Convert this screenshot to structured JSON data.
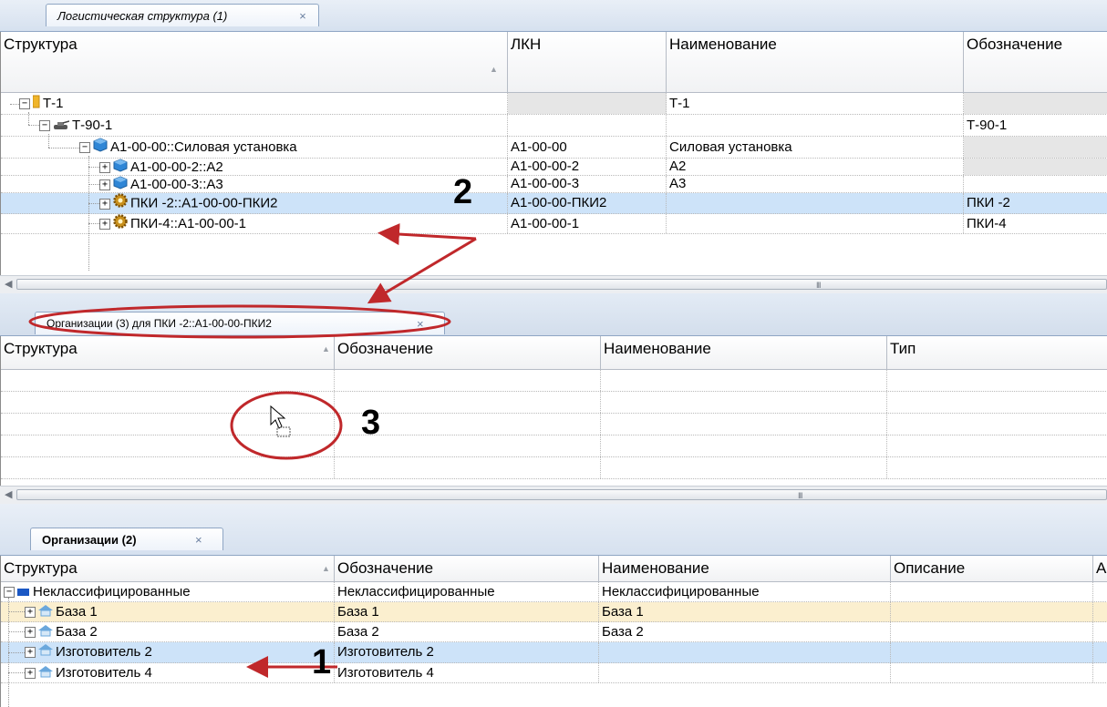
{
  "panel1": {
    "tab_label": "Логистическая структура (1)",
    "close": "×",
    "headers": [
      "Структура",
      "ЛКН",
      "Наименование",
      "Обозначение"
    ],
    "rows": [
      {
        "structure": "Т-1",
        "lkn": "",
        "name": "Т-1",
        "designation": ""
      },
      {
        "structure": "Т-90-1",
        "lkn": "",
        "name": "",
        "designation": "Т-90-1"
      },
      {
        "structure": "А1-00-00::Силовая установка",
        "lkn": "А1-00-00",
        "name": "Силовая установка",
        "designation": ""
      },
      {
        "structure": "А1-00-00-2::А2",
        "lkn": "А1-00-00-2",
        "name": "А2",
        "designation": ""
      },
      {
        "structure": "А1-00-00-3::А3",
        "lkn": "А1-00-00-3",
        "name": "А3",
        "designation": ""
      },
      {
        "structure": "ПКИ -2::А1-00-00-ПКИ2",
        "lkn": "А1-00-00-ПКИ2",
        "name": "",
        "designation": "ПКИ -2"
      },
      {
        "structure": "ПКИ-4::А1-00-00-1",
        "lkn": "А1-00-00-1",
        "name": "",
        "designation": "ПКИ-4"
      }
    ],
    "scroll_grip": "III"
  },
  "panel2": {
    "tab_label": "Организации (3) для ПКИ -2::А1-00-00-ПКИ2",
    "close": "×",
    "headers": [
      "Структура",
      "Обозначение",
      "Наименование",
      "Тип"
    ],
    "scroll_grip": "III"
  },
  "panel3": {
    "tab_label": "Организации (2)",
    "close": "×",
    "headers": [
      "Структура",
      "Обозначение",
      "Наименование",
      "Описание",
      "А"
    ],
    "rows": [
      {
        "structure": "Неклассифицированные",
        "designation": "Неклассифицированные",
        "name": "Неклассифицированные"
      },
      {
        "structure": "База 1",
        "designation": "База 1",
        "name": "База 1"
      },
      {
        "structure": "База 2",
        "designation": "База 2",
        "name": "База 2"
      },
      {
        "structure": "Изготовитель 2",
        "designation": "Изготовитель 2",
        "name": ""
      },
      {
        "structure": "Изготовитель 4",
        "designation": "Изготовитель 4",
        "name": ""
      }
    ]
  },
  "annotations": {
    "n1": "1",
    "n2": "2",
    "n3": "3",
    "arrow_color": "#c0282b"
  },
  "icons": {
    "folder": "folder-icon",
    "tank": "tank-icon",
    "cube": "cube-icon",
    "gear": "gear-icon",
    "org": "organization-icon",
    "category": "category-icon",
    "cursor": "drag-cursor-icon"
  }
}
